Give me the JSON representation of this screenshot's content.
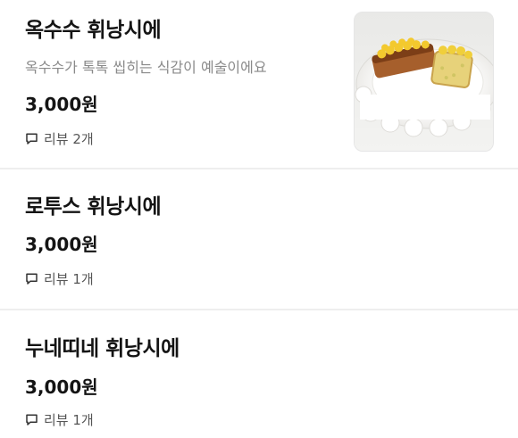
{
  "menu_items": [
    {
      "name": "옥수수 휘낭시에",
      "description": "옥수수가 톡톡 씹히는 식감이 예술이에요",
      "price": "3,000원",
      "review_text": "리뷰 2개",
      "icon": "speech-bubble-icon",
      "image": "corn-financier-photo"
    },
    {
      "name": "로투스 휘낭시에",
      "price": "3,000원",
      "review_text": "리뷰 1개",
      "icon": "speech-bubble-icon"
    },
    {
      "name": "누네띠네 휘낭시에",
      "price": "3,000원",
      "review_text": "리뷰 1개",
      "icon": "speech-bubble-icon"
    }
  ]
}
